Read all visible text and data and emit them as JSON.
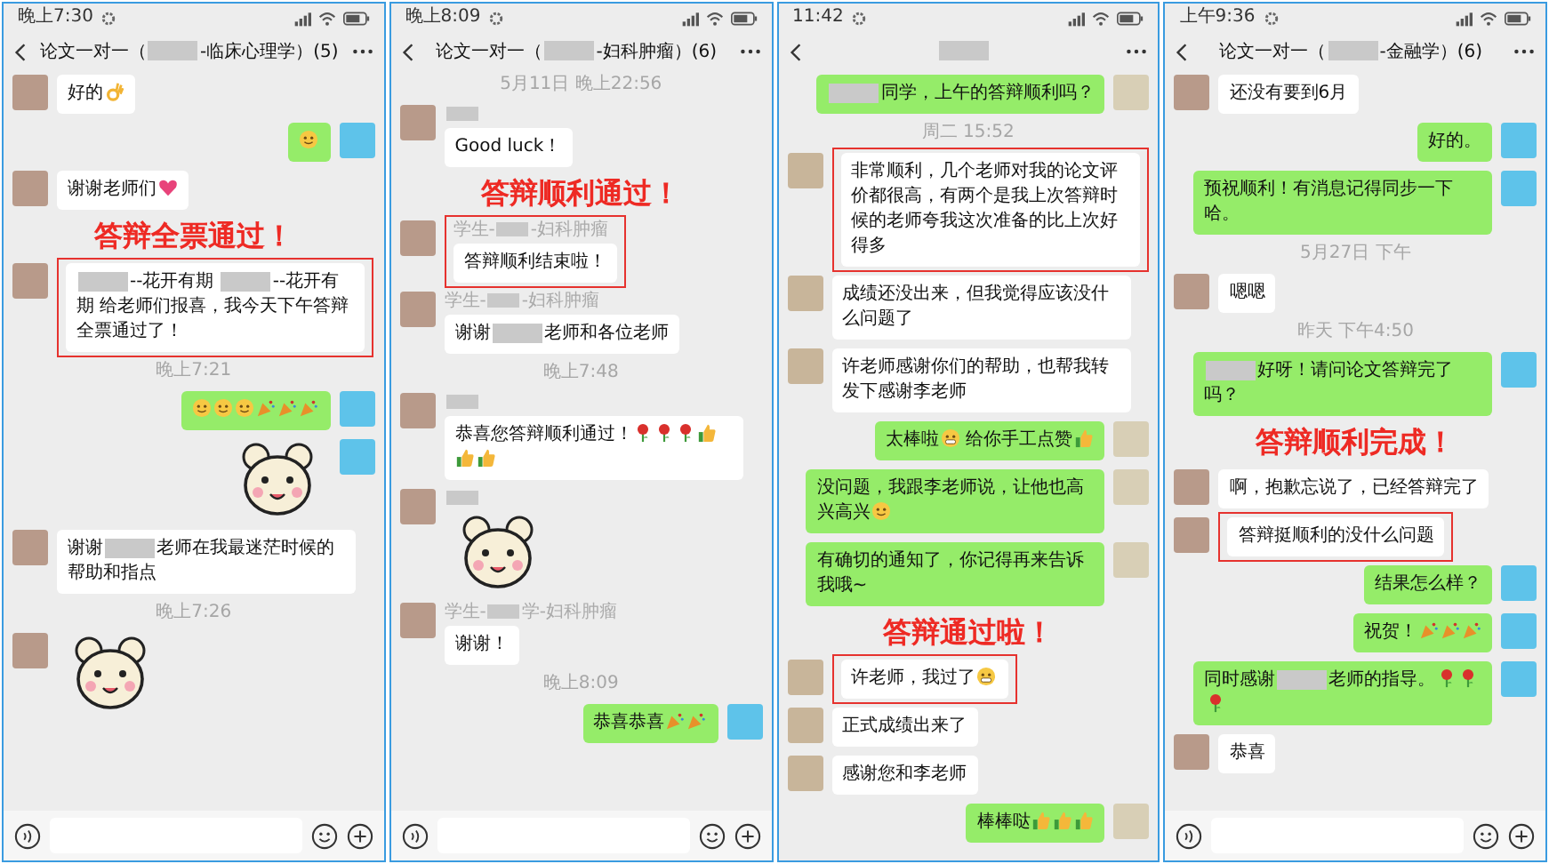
{
  "phones": [
    {
      "status_time": "晚上7:30",
      "title": [
        {
          "kind": "text",
          "text": "论文一对一（"
        },
        {
          "kind": "blur"
        },
        {
          "kind": "text",
          "text": "-临床心理学）(5)"
        }
      ],
      "input_bar": true,
      "messages": [
        {
          "kind": "text",
          "outgoing": false,
          "highlighted": false,
          "parts": [
            {
              "kind": "text",
              "text": "好的"
            },
            {
              "kind": "ok"
            }
          ]
        },
        {
          "kind": "text",
          "outgoing": true,
          "highlighted": false,
          "parts": [
            {
              "kind": "smiley"
            }
          ]
        },
        {
          "kind": "text",
          "outgoing": false,
          "highlighted": false,
          "parts": [
            {
              "kind": "text",
              "text": "谢谢老师们"
            },
            {
              "kind": "heart"
            }
          ]
        },
        {
          "kind": "callout",
          "text": "答辩全票通过！"
        },
        {
          "kind": "text",
          "outgoing": false,
          "highlighted": true,
          "parts": [
            {
              "kind": "blur"
            },
            {
              "kind": "text",
              "text": "--花开有期 "
            },
            {
              "kind": "blur"
            },
            {
              "kind": "text",
              "text": "--花开有期 给老师们报喜，我今天下午答辩全票通过了！"
            }
          ]
        },
        {
          "kind": "time",
          "text": "晚上7:21"
        },
        {
          "kind": "text",
          "outgoing": true,
          "highlighted": false,
          "parts": [
            {
              "kind": "smiley"
            },
            {
              "kind": "smiley"
            },
            {
              "kind": "smiley"
            },
            {
              "kind": "party"
            },
            {
              "kind": "party"
            },
            {
              "kind": "party"
            }
          ]
        },
        {
          "kind": "sticker",
          "outgoing": true
        },
        {
          "kind": "text",
          "outgoing": false,
          "highlighted": false,
          "parts": [
            {
              "kind": "text",
              "text": "谢谢"
            },
            {
              "kind": "blur"
            },
            {
              "kind": "text",
              "text": "老师在我最迷茫时候的帮助和指点"
            }
          ]
        },
        {
          "kind": "time",
          "text": "晚上7:26"
        },
        {
          "kind": "sticker",
          "outgoing": false
        }
      ]
    },
    {
      "status_time": "晚上8:09",
      "title": [
        {
          "kind": "text",
          "text": "论文一对一（"
        },
        {
          "kind": "blur"
        },
        {
          "kind": "text",
          "text": "-妇科肿瘤）(6)"
        }
      ],
      "input_bar": true,
      "messages": [
        {
          "kind": "time",
          "text": "5月11日 晚上22:56"
        },
        {
          "kind": "text",
          "outgoing": false,
          "highlighted": false,
          "sender": [
            {
              "kind": "blur"
            }
          ],
          "parts": [
            {
              "kind": "text",
              "text": "Good luck！"
            }
          ]
        },
        {
          "kind": "callout",
          "text": "答辩顺利通过！"
        },
        {
          "kind": "text",
          "outgoing": false,
          "highlighted": true,
          "sender": [
            {
              "kind": "text",
              "text": "学生-"
            },
            {
              "kind": "blur"
            },
            {
              "kind": "text",
              "text": "-妇科肿瘤"
            }
          ],
          "parts": [
            {
              "kind": "text",
              "text": "答辩顺利结束啦！"
            }
          ]
        },
        {
          "kind": "text",
          "outgoing": false,
          "highlighted": false,
          "sender": [
            {
              "kind": "text",
              "text": "学生-"
            },
            {
              "kind": "blur"
            },
            {
              "kind": "text",
              "text": "-妇科肿瘤"
            }
          ],
          "parts": [
            {
              "kind": "text",
              "text": "谢谢"
            },
            {
              "kind": "blur"
            },
            {
              "kind": "text",
              "text": "老师和各位老师"
            }
          ]
        },
        {
          "kind": "time",
          "text": "晚上7:48"
        },
        {
          "kind": "text",
          "outgoing": false,
          "highlighted": false,
          "sender": [
            {
              "kind": "blur"
            }
          ],
          "parts": [
            {
              "kind": "text",
              "text": "恭喜您答辩顺利通过！"
            },
            {
              "kind": "rose"
            },
            {
              "kind": "rose"
            },
            {
              "kind": "rose"
            },
            {
              "kind": "thumb"
            },
            {
              "kind": "thumb"
            },
            {
              "kind": "thumb"
            }
          ]
        },
        {
          "kind": "sticker",
          "outgoing": false,
          "sender": [
            {
              "kind": "blur"
            }
          ]
        },
        {
          "kind": "text",
          "outgoing": false,
          "highlighted": false,
          "sender": [
            {
              "kind": "text",
              "text": "学生-"
            },
            {
              "kind": "blur"
            },
            {
              "kind": "text",
              "text": "学-妇科肿瘤"
            }
          ],
          "parts": [
            {
              "kind": "text",
              "text": "谢谢！"
            }
          ]
        },
        {
          "kind": "time",
          "text": "晚上8:09"
        },
        {
          "kind": "text",
          "outgoing": true,
          "highlighted": false,
          "parts": [
            {
              "kind": "text",
              "text": "恭喜恭喜"
            },
            {
              "kind": "party"
            },
            {
              "kind": "party"
            }
          ]
        }
      ]
    },
    {
      "status_time": "11:42",
      "title": [
        {
          "kind": "blur"
        }
      ],
      "input_bar": false,
      "messages": [
        {
          "kind": "text",
          "outgoing": true,
          "highlighted": false,
          "parts": [
            {
              "kind": "blur"
            },
            {
              "kind": "text",
              "text": "同学，上午的答辩顺利吗？"
            }
          ]
        },
        {
          "kind": "time",
          "text": "周二 15:52"
        },
        {
          "kind": "text",
          "outgoing": false,
          "highlighted": true,
          "parts": [
            {
              "kind": "text",
              "text": "非常顺利，几个老师对我的论文评价都很高，有两个是我上次答辩时候的老师夸我这次准备的比上次好得多"
            }
          ]
        },
        {
          "kind": "text",
          "outgoing": false,
          "highlighted": false,
          "parts": [
            {
              "kind": "text",
              "text": "成绩还没出来，但我觉得应该没什么问题了"
            }
          ]
        },
        {
          "kind": "text",
          "outgoing": false,
          "highlighted": false,
          "parts": [
            {
              "kind": "text",
              "text": "许老师感谢你们的帮助，也帮我转发下感谢李老师"
            }
          ]
        },
        {
          "kind": "text",
          "outgoing": true,
          "highlighted": false,
          "parts": [
            {
              "kind": "text",
              "text": "太棒啦"
            },
            {
              "kind": "grin"
            },
            {
              "kind": "text",
              "text": " 给你手工点赞"
            },
            {
              "kind": "thumb"
            }
          ]
        },
        {
          "kind": "text",
          "outgoing": true,
          "highlighted": false,
          "parts": [
            {
              "kind": "text",
              "text": "没问题，我跟李老师说，让他也高兴高兴"
            },
            {
              "kind": "smiley"
            }
          ]
        },
        {
          "kind": "text",
          "outgoing": true,
          "highlighted": false,
          "parts": [
            {
              "kind": "text",
              "text": "有确切的通知了，你记得再来告诉我哦~"
            }
          ]
        },
        {
          "kind": "callout",
          "text": "答辩通过啦！"
        },
        {
          "kind": "text",
          "outgoing": false,
          "highlighted": true,
          "parts": [
            {
              "kind": "text",
              "text": "许老师，我过了"
            },
            {
              "kind": "grin"
            }
          ]
        },
        {
          "kind": "text",
          "outgoing": false,
          "highlighted": false,
          "parts": [
            {
              "kind": "text",
              "text": "正式成绩出来了"
            }
          ]
        },
        {
          "kind": "text",
          "outgoing": false,
          "highlighted": false,
          "parts": [
            {
              "kind": "text",
              "text": "感谢您和李老师"
            }
          ]
        },
        {
          "kind": "text",
          "outgoing": true,
          "highlighted": false,
          "parts": [
            {
              "kind": "text",
              "text": "棒棒哒"
            },
            {
              "kind": "thumb"
            },
            {
              "kind": "thumb"
            },
            {
              "kind": "thumb"
            }
          ]
        }
      ]
    },
    {
      "status_time": "上午9:36",
      "title": [
        {
          "kind": "text",
          "text": "论文一对一（"
        },
        {
          "kind": "blur"
        },
        {
          "kind": "text",
          "text": "-金融学）(6)"
        }
      ],
      "input_bar": true,
      "messages": [
        {
          "kind": "text",
          "outgoing": false,
          "highlighted": false,
          "parts": [
            {
              "kind": "text",
              "text": "还没有要到6月"
            }
          ]
        },
        {
          "kind": "text",
          "outgoing": true,
          "highlighted": false,
          "parts": [
            {
              "kind": "text",
              "text": "好的。"
            }
          ]
        },
        {
          "kind": "text",
          "outgoing": true,
          "highlighted": false,
          "parts": [
            {
              "kind": "text",
              "text": "预祝顺利！有消息记得同步一下哈。"
            }
          ]
        },
        {
          "kind": "time",
          "text": "5月27日 下午"
        },
        {
          "kind": "text",
          "outgoing": false,
          "highlighted": false,
          "parts": [
            {
              "kind": "text",
              "text": "嗯嗯"
            }
          ]
        },
        {
          "kind": "time",
          "text": "昨天 下午4:50"
        },
        {
          "kind": "text",
          "outgoing": true,
          "highlighted": false,
          "parts": [
            {
              "kind": "blur"
            },
            {
              "kind": "text",
              "text": "好呀！请问论文答辩完了吗？"
            }
          ]
        },
        {
          "kind": "callout",
          "text": "答辩顺利完成！"
        },
        {
          "kind": "text",
          "outgoing": false,
          "highlighted": false,
          "parts": [
            {
              "kind": "text",
              "text": "啊，抱歉忘说了，已经答辩完了"
            }
          ]
        },
        {
          "kind": "text",
          "outgoing": false,
          "highlighted": true,
          "parts": [
            {
              "kind": "text",
              "text": "答辩挺顺利的没什么问题"
            }
          ]
        },
        {
          "kind": "text",
          "outgoing": true,
          "highlighted": false,
          "parts": [
            {
              "kind": "text",
              "text": "结果怎么样？"
            }
          ]
        },
        {
          "kind": "text",
          "outgoing": true,
          "highlighted": false,
          "parts": [
            {
              "kind": "text",
              "text": "祝贺！"
            },
            {
              "kind": "party"
            },
            {
              "kind": "party"
            },
            {
              "kind": "party"
            }
          ]
        },
        {
          "kind": "text",
          "outgoing": true,
          "highlighted": false,
          "parts": [
            {
              "kind": "text",
              "text": "同时感谢"
            },
            {
              "kind": "blur"
            },
            {
              "kind": "text",
              "text": "老师的指导。"
            },
            {
              "kind": "rose"
            },
            {
              "kind": "rose"
            },
            {
              "kind": "rose"
            }
          ]
        },
        {
          "kind": "text",
          "outgoing": false,
          "highlighted": false,
          "parts": [
            {
              "kind": "text",
              "text": "恭喜"
            }
          ]
        }
      ]
    }
  ]
}
